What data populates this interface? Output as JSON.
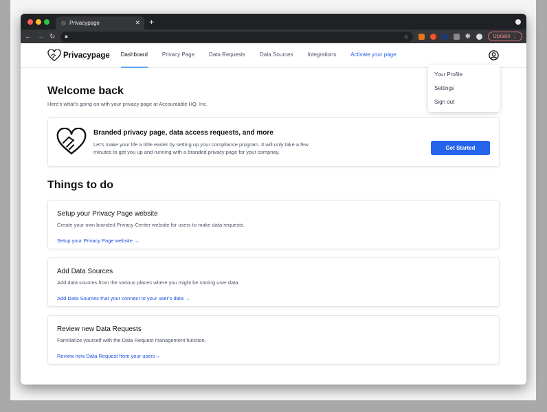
{
  "browser": {
    "tab_title": "Privacypage",
    "update_label": "Update",
    "colors": {
      "accent": "#2563eb"
    }
  },
  "nav": {
    "brand": "Privacypage",
    "items": [
      "Dashboard",
      "Privacy Page",
      "Data Requests",
      "Data Sources",
      "Integrations"
    ],
    "activate": "Activate your page"
  },
  "dropdown": [
    "Your Profile",
    "Settings",
    "Sign out"
  ],
  "main": {
    "title": "Welcome back",
    "subtitle": "Here's what's going on with your privacy page at Accountable HQ, Inc.",
    "hero": {
      "title": "Branded privacy page, data access requests, and more",
      "text": "Let's make your life a little easier by setting up your compliance program.  It will only take a few minutes to get you up and running with a branded privacy page for your compnay.",
      "button": "Get Started"
    },
    "todo_title": "Things to do",
    "cards": [
      {
        "title": "Setup your Privacy Page website",
        "text": "Create your own branded Privacy Center website for users to make data requests.",
        "link": "Setup your Privacy Page website →"
      },
      {
        "title": "Add Data Sources",
        "text": "Add data sources from the various places where you might be storing user data.",
        "link": "Add Data Sources that your connect to your user's data →"
      },
      {
        "title": "Review new Data Requests",
        "text": "Familiarize yourself with the Data Request management function.",
        "link": "Review new Data Request from your users→"
      }
    ]
  }
}
